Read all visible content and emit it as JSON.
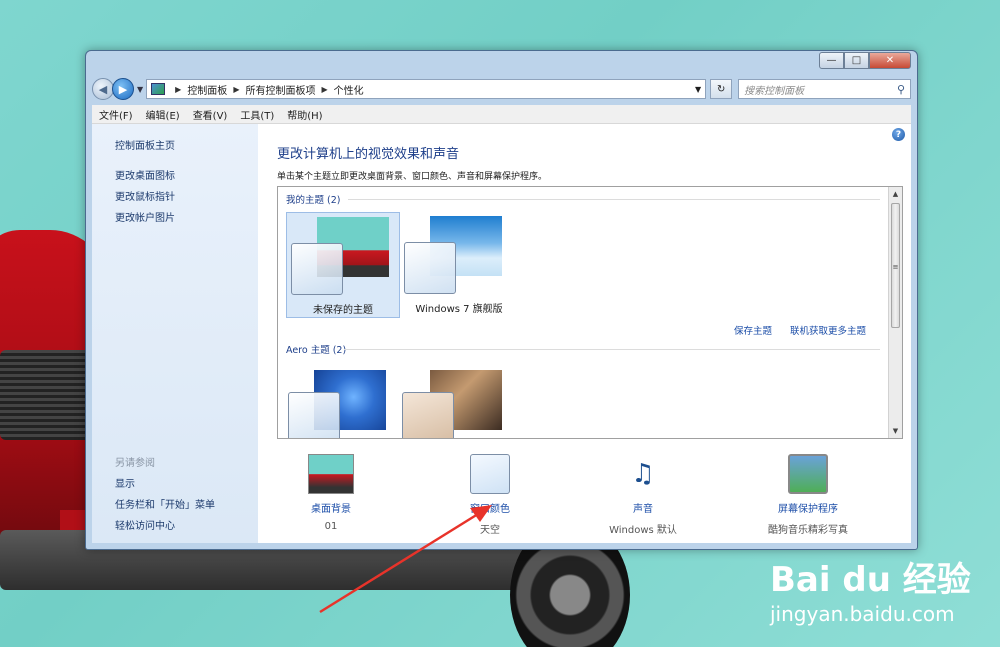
{
  "window": {
    "buttons": {
      "minimize": "—",
      "maximize": "□",
      "close": "✕"
    }
  },
  "address_bar": {
    "breadcrumbs": [
      "控制面板",
      "所有控制面板项",
      "个性化"
    ],
    "search_placeholder": "搜索控制面板"
  },
  "menu": [
    "文件(F)",
    "编辑(E)",
    "查看(V)",
    "工具(T)",
    "帮助(H)"
  ],
  "sidebar": {
    "top_links": [
      "控制面板主页",
      "更改桌面图标",
      "更改鼠标指针",
      "更改帐户图片"
    ],
    "see_also_heading": "另请参阅",
    "see_also_links": [
      "显示",
      "任务栏和「开始」菜单",
      "轻松访问中心"
    ]
  },
  "main": {
    "help_icon": "?",
    "title": "更改计算机上的视觉效果和声音",
    "description": "单击某个主题立即更改桌面背景、窗口颜色、声音和屏幕保护程序。",
    "my_themes_label": "我的主题 (2)",
    "my_themes": [
      {
        "name": "未保存的主题",
        "selected": true
      },
      {
        "name": "Windows 7 旗舰版",
        "selected": false
      }
    ],
    "save_theme": "保存主题",
    "get_more_online": "联机获取更多主题",
    "aero_label": "Aero 主题 (2)",
    "scroll_mid_glyph": "≡"
  },
  "bottom": [
    {
      "label": "桌面背景",
      "sub": "01",
      "icon": "desktop-background-icon"
    },
    {
      "label": "窗口颜色",
      "sub": "天空",
      "icon": "window-color-icon"
    },
    {
      "label": "声音",
      "sub": "Windows 默认",
      "icon": "sound-icon"
    },
    {
      "label": "屏幕保护程序",
      "sub": "酷狗音乐精彩写真",
      "icon": "screensaver-icon"
    }
  ],
  "watermark": {
    "brand": "Bai du 经验",
    "url": "jingyan.baidu.com"
  },
  "colors": {
    "link": "#1c4ea8",
    "title": "#1e3f8a",
    "annotation": "#e8332a"
  }
}
